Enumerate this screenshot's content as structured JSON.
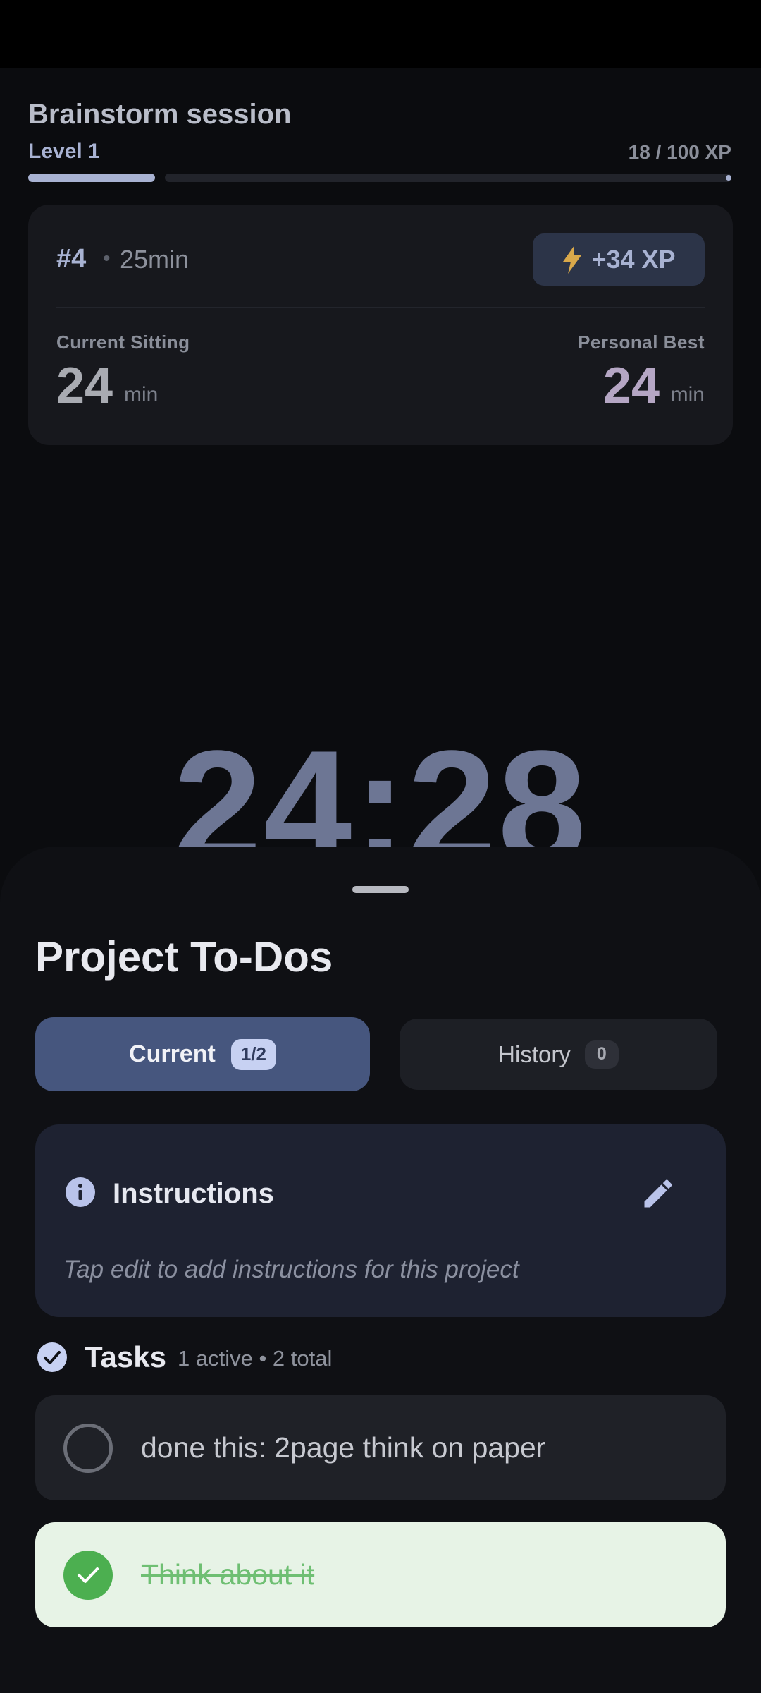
{
  "session": {
    "title": "Brainstorm session",
    "level_label": "Level 1",
    "xp_text": "18 / 100 XP",
    "xp_progress": 0.18
  },
  "session_card": {
    "number": "#4",
    "separator": "•",
    "duration": "25min",
    "xp_gain": "+34 XP",
    "bolt_icon": "lightning-bolt-icon",
    "current_sitting_label": "Current Sitting",
    "current_sitting_value": "24",
    "current_sitting_unit": "min",
    "personal_best_label": "Personal Best",
    "personal_best_value": "24",
    "personal_best_unit": "min"
  },
  "timer": {
    "display": "24:28"
  },
  "sheet": {
    "title": "Project To-Dos",
    "tabs": {
      "current_label": "Current",
      "current_badge": "1/2",
      "history_label": "History",
      "history_badge": "0"
    },
    "instructions": {
      "title": "Instructions",
      "hint": "Tap edit to add instructions for this project",
      "info_icon": "info-icon",
      "edit_icon": "pencil-edit-icon"
    },
    "tasks": {
      "title": "Tasks",
      "count": "1 active • 2 total",
      "items": [
        {
          "text": "done this: 2page think on paper",
          "done": false
        },
        {
          "text": "Think about it",
          "done": true
        }
      ]
    }
  },
  "colors": {
    "accent": "#a8b2d2",
    "timer": "#6d7694",
    "tab_active": "#46567e",
    "done_green": "#4caf50",
    "done_bg": "#e7f3e6"
  }
}
